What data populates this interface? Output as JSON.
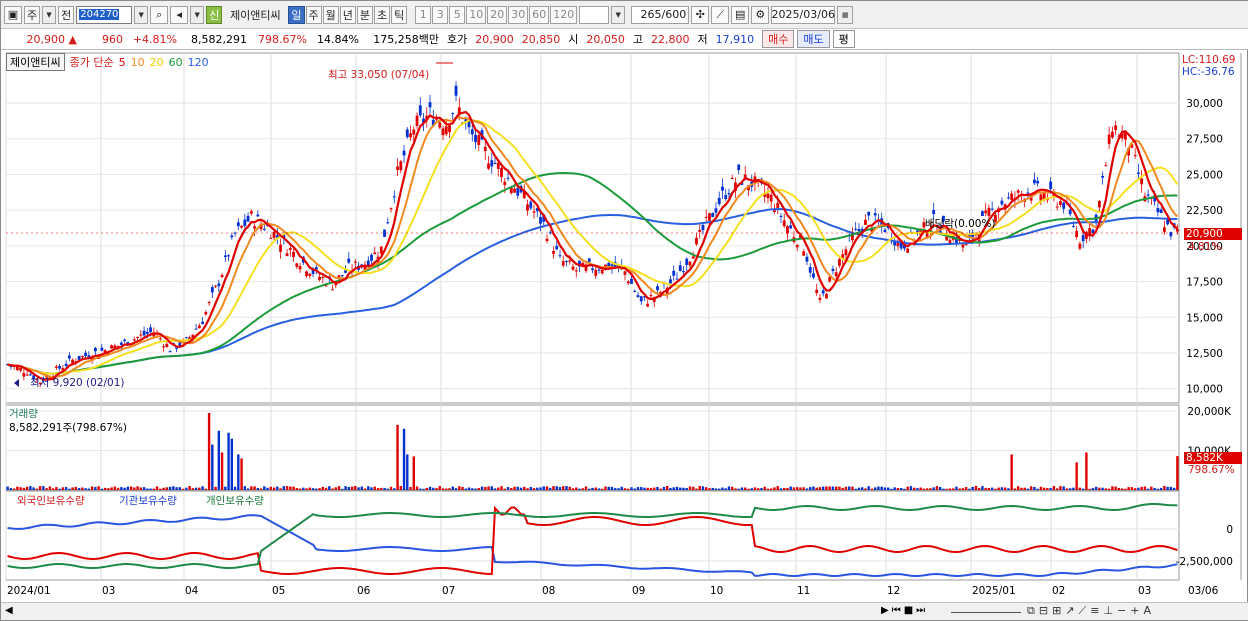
{
  "toolbar": {
    "market": "주",
    "prev": "전",
    "code": "204270",
    "stock_name": "제이앤티씨",
    "new_badge": "신",
    "periods": [
      "일",
      "주",
      "월",
      "년",
      "분",
      "초",
      "틱"
    ],
    "active_period": "일",
    "intervals": [
      "1",
      "3",
      "5",
      "10",
      "20",
      "30",
      "60",
      "120"
    ],
    "count": "265",
    "count_max": "/600",
    "date": "2025/03/06"
  },
  "infobar": {
    "price": "20,900",
    "arrow": "▲",
    "change": "960",
    "pct": "+4.81%",
    "volume": "8,582,291",
    "vol_pct": "798.67%",
    "turnover": "14.84%",
    "amount": "175,258백만",
    "quote_label": "호가",
    "ask": "20,900",
    "bid": "20,850",
    "open_label": "시",
    "open": "20,050",
    "high_label": "고",
    "high": "22,800",
    "low_label": "저",
    "low": "17,910",
    "buy": "매수",
    "sell": "매도",
    "eval": "평"
  },
  "legend": {
    "name": "제이앤티씨",
    "ma_label": "종가 단순",
    "ma": [
      "5",
      "10",
      "20",
      "60",
      "120"
    ]
  },
  "colors": {
    "up": "#e00000",
    "down": "#0030d0",
    "ma5": "#e00000",
    "ma10": "#f08a20",
    "ma20": "#f5e020",
    "ma60": "#1d9a3a",
    "ma120": "#2a5fe0"
  },
  "price_panel": {
    "lc": "LC:110.69",
    "hc": "HC:-36.76",
    "y_ticks": [
      "30,000",
      "27,500",
      "25,000",
      "22,500",
      "20,000",
      "17,500",
      "15,000",
      "12,500",
      "10,000"
    ],
    "high_note": "최고 33,050 (07/04)",
    "low_note": "최저 9,920 (02/01)",
    "div_note": "배당락(0.00%)",
    "cur_price": "20,900",
    "cur_pct": "4.81%"
  },
  "volume_panel": {
    "title": "거래량",
    "value": "8,582,291주(798.67%)",
    "y_ticks": [
      "20,000K",
      "10,000K"
    ],
    "cur": "8,582K",
    "cur_pct": "798.67%"
  },
  "holding_panel": {
    "labels": [
      "외국인보유수량",
      "기관보유수량",
      "개인보유수량"
    ],
    "y_ticks": [
      "0",
      "-2,500,000"
    ]
  },
  "x_axis": [
    "2024/01",
    "03",
    "04",
    "05",
    "06",
    "07",
    "08",
    "09",
    "10",
    "11",
    "12",
    "2025/01",
    "02",
    "03",
    "03/06"
  ],
  "chart_data": {
    "type": "candlestick",
    "x_range": [
      "2024/01",
      "2025/03/06"
    ],
    "ylim": [
      9000,
      33500
    ],
    "y_ticks": [
      10000,
      12500,
      15000,
      17500,
      20000,
      22500,
      25000,
      27500,
      30000
    ],
    "close_path": [
      [
        0,
        11700
      ],
      [
        6,
        11200
      ],
      [
        10,
        10500
      ],
      [
        15,
        11300
      ],
      [
        20,
        12000
      ],
      [
        25,
        12400
      ],
      [
        30,
        12700
      ],
      [
        35,
        13100
      ],
      [
        40,
        13600
      ],
      [
        45,
        14000
      ],
      [
        50,
        12800
      ],
      [
        55,
        13300
      ],
      [
        60,
        14800
      ],
      [
        65,
        17500
      ],
      [
        70,
        20800
      ],
      [
        75,
        22000
      ],
      [
        80,
        21300
      ],
      [
        85,
        20200
      ],
      [
        90,
        19000
      ],
      [
        95,
        18000
      ],
      [
        100,
        17300
      ],
      [
        105,
        18400
      ],
      [
        110,
        18800
      ],
      [
        115,
        19800
      ],
      [
        120,
        25000
      ],
      [
        125,
        28300
      ],
      [
        130,
        29200
      ],
      [
        135,
        28600
      ],
      [
        138,
        30000
      ],
      [
        142,
        28000
      ],
      [
        146,
        26800
      ],
      [
        150,
        25800
      ],
      [
        155,
        24400
      ],
      [
        160,
        23000
      ],
      [
        165,
        21500
      ],
      [
        170,
        19000
      ],
      [
        175,
        18300
      ],
      [
        180,
        18500
      ],
      [
        185,
        18600
      ],
      [
        190,
        18200
      ],
      [
        195,
        16000
      ],
      [
        200,
        16600
      ],
      [
        205,
        17600
      ],
      [
        210,
        19300
      ],
      [
        215,
        21500
      ],
      [
        220,
        23500
      ],
      [
        225,
        24800
      ],
      [
        230,
        24300
      ],
      [
        235,
        23300
      ],
      [
        240,
        21400
      ],
      [
        245,
        20000
      ],
      [
        250,
        16000
      ],
      [
        255,
        18500
      ],
      [
        260,
        20600
      ],
      [
        265,
        21800
      ],
      [
        270,
        21300
      ],
      [
        275,
        20000
      ],
      [
        280,
        20800
      ],
      [
        285,
        21700
      ],
      [
        290,
        20900
      ],
      [
        295,
        19900
      ],
      [
        300,
        21700
      ],
      [
        305,
        22900
      ],
      [
        310,
        23400
      ],
      [
        315,
        24000
      ],
      [
        320,
        23500
      ],
      [
        325,
        23000
      ],
      [
        330,
        20500
      ],
      [
        335,
        21600
      ],
      [
        340,
        28500
      ],
      [
        345,
        27200
      ],
      [
        350,
        23600
      ],
      [
        355,
        22000
      ],
      [
        358,
        21000
      ],
      [
        360,
        20900
      ]
    ],
    "ma_series": [
      "5",
      "10",
      "20",
      "60",
      "120"
    ],
    "volume_max": 20000000,
    "last_volume": 8582291
  }
}
